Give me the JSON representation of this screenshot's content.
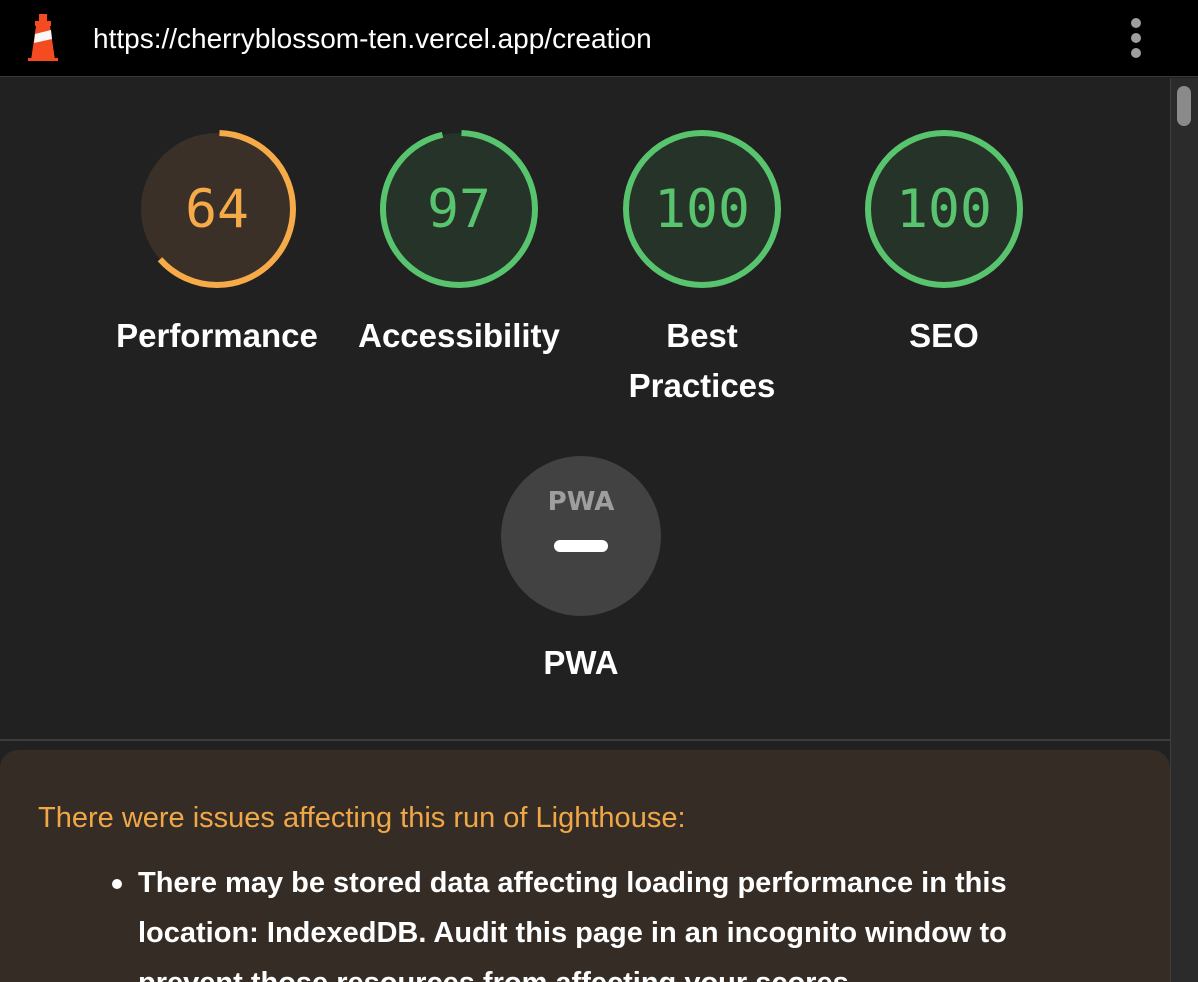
{
  "browser": {
    "url": "https://cherryblossom-ten.vercel.app/creation",
    "logo_icon": "lighthouse-icon",
    "menu_icon": "more-vert-icon"
  },
  "scores": [
    {
      "label": "Performance",
      "value": "64",
      "score_fraction": 0.64,
      "color": "#f6ab48",
      "bg": "#3a3028",
      "track": "#3a3028"
    },
    {
      "label": "Accessibility",
      "value": "97",
      "score_fraction": 0.97,
      "color": "#58c46e",
      "bg": "#263329",
      "track": "#263329"
    },
    {
      "label": "Best Practices",
      "value": "100",
      "score_fraction": 1.0,
      "color": "#58c46e",
      "bg": "#263329",
      "track": "#263329"
    },
    {
      "label": "SEO",
      "value": "100",
      "score_fraction": 1.0,
      "color": "#58c46e",
      "bg": "#263329",
      "track": "#263329"
    }
  ],
  "pwa": {
    "label": "PWA",
    "badge_text": "PWA",
    "bg": "#424242",
    "icon": "dash-icon"
  },
  "warning": {
    "title": "There were issues affecting this run of Lighthouse:",
    "items": [
      "There may be stored data affecting loading performance in this location: IndexedDB. Audit this page in an incognito window to prevent those resources from affecting your scores."
    ],
    "title_color": "#f0a747",
    "bg": "#342c25"
  }
}
